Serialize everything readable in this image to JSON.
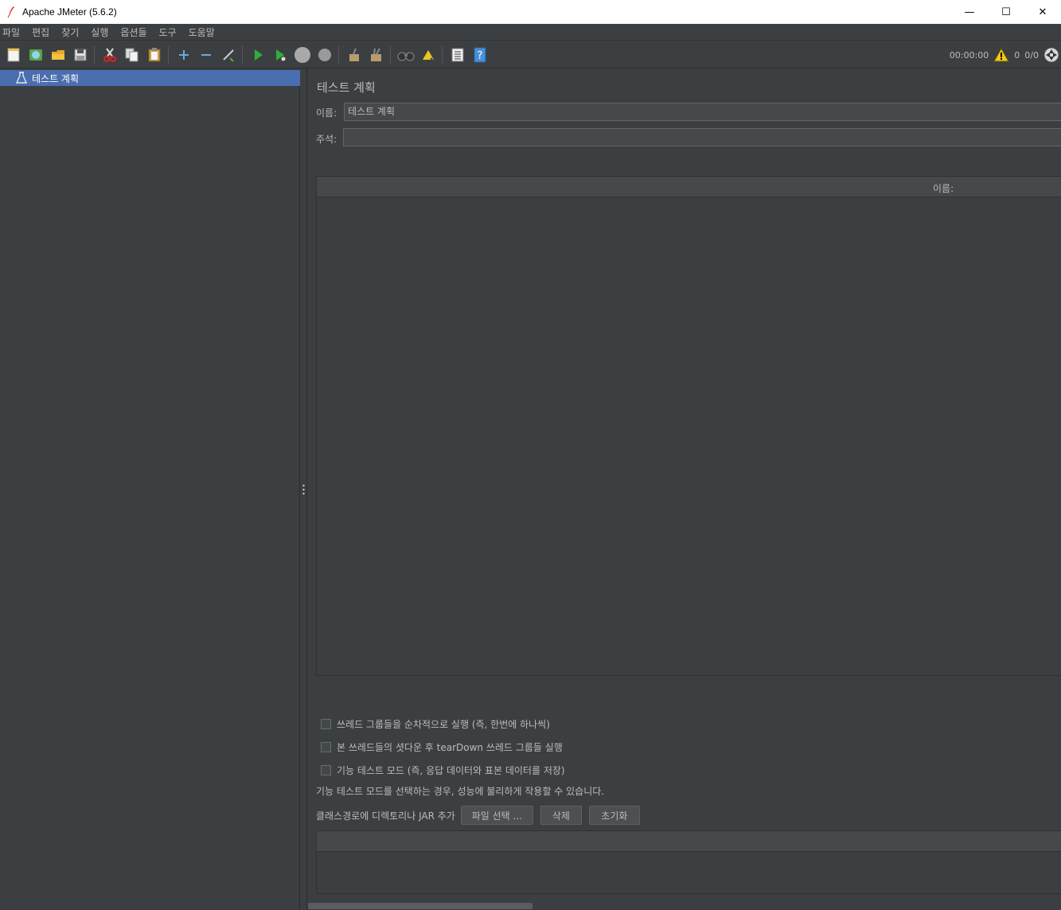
{
  "window": {
    "title": "Apache JMeter (5.6.2)",
    "minimize_glyph": "—",
    "maximize_glyph": "☐",
    "close_glyph": "✕"
  },
  "menu": [
    "파일",
    "편집",
    "찾기",
    "실행",
    "옵션들",
    "도구",
    "도움말"
  ],
  "toolbar": {
    "timer": "00:00:00",
    "warning_count": "0",
    "thread_count": "0/0"
  },
  "tree": {
    "root_label": "테스트 계획"
  },
  "panel": {
    "title": "테스트 계획",
    "name_label": "이름:",
    "name_value": "테스트 계획",
    "comment_label": "주석:",
    "comment_value": "",
    "variables_table_header": "이름:",
    "checkboxes": [
      {
        "label": "쓰레드 그룹들을 순차적으로 실행 (즉, 한번에 하나씩)",
        "checked": false
      },
      {
        "label": "본 쓰레드들의 셧다운 후 tearDown 쓰레드 그룹들 실행",
        "checked": false
      },
      {
        "label": "기능 테스트 모드 (즉, 응답 데이터와 표본 데이터를 저장)",
        "checked": false
      }
    ],
    "functional_note": "기능 테스트 모드를 선택하는 경우, 성능에 불리하게 작용할 수 있습니다.",
    "classpath_label": "클래스경로에 디렉토리나 JAR 추가",
    "browse_button": "파일 선택 ...",
    "delete_button": "삭제",
    "clear_button": "초기화"
  }
}
